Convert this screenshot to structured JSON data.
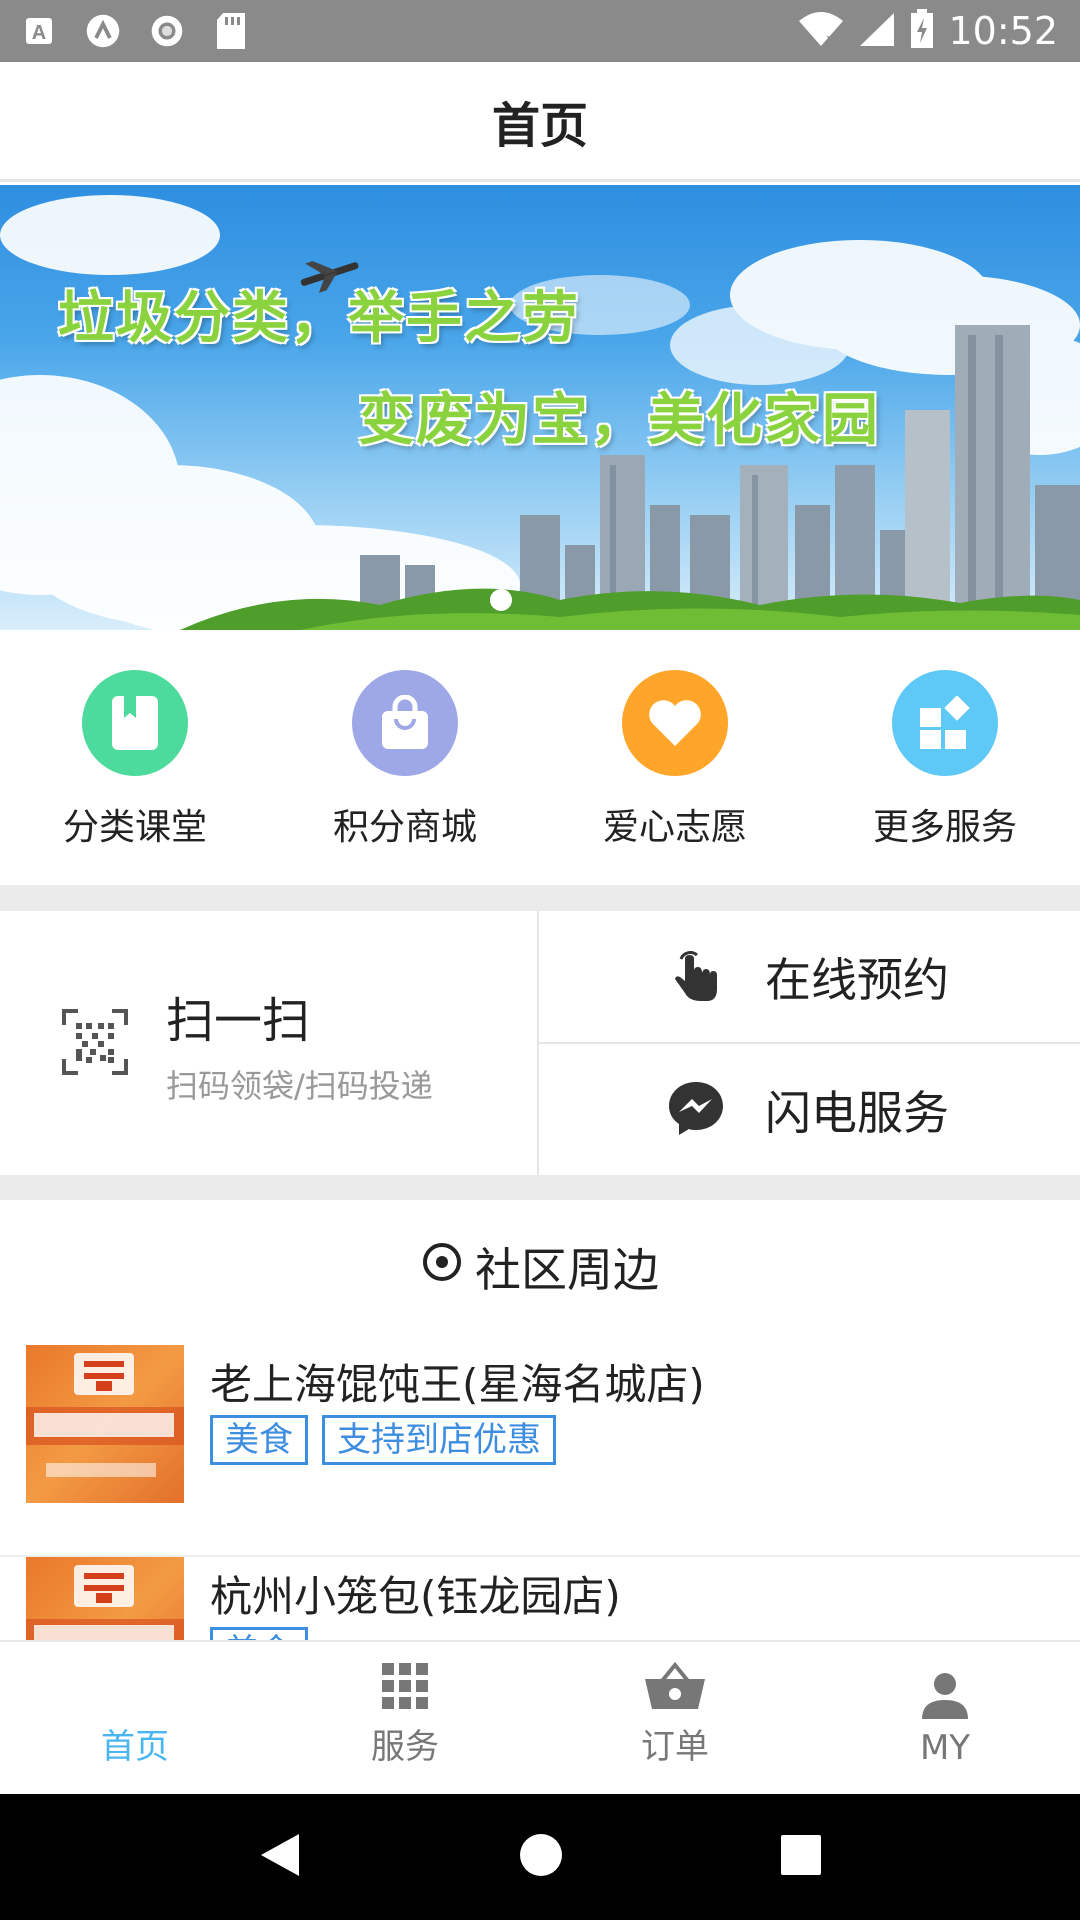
{
  "status_bar": {
    "time": "10:52",
    "icons": [
      "a-icon",
      "lambda-icon",
      "record-icon",
      "sd-card-icon",
      "wifi-icon",
      "signal-icon",
      "battery-icon"
    ]
  },
  "header": {
    "title": "首页"
  },
  "banner": {
    "line1": "垃圾分类，举手之劳",
    "line2": "变废为宝，美化家园",
    "slides_total": 1,
    "current_slide": 1
  },
  "quick_menu": [
    {
      "label": "分类课堂",
      "icon": "book-icon",
      "color": "#4cdb9c"
    },
    {
      "label": "积分商城",
      "icon": "shopping-bag-icon",
      "color": "#9fa8e6"
    },
    {
      "label": "爱心志愿",
      "icon": "heart-icon",
      "color": "#ffa52a"
    },
    {
      "label": "更多服务",
      "icon": "apps-icon",
      "color": "#5ec9f6"
    }
  ],
  "actions": {
    "scan": {
      "title": "扫一扫",
      "subtitle": "扫码领袋/扫码投递",
      "icon": "qr-code-icon"
    },
    "items": [
      {
        "label": "在线预约",
        "icon": "touch-icon"
      },
      {
        "label": "闪电服务",
        "icon": "messenger-icon"
      }
    ]
  },
  "community": {
    "title": "社区周边",
    "shops": [
      {
        "name": "老上海馄饨王(星海名城店)",
        "tags": [
          "美食",
          "支持到店优惠"
        ]
      },
      {
        "name": "杭州小笼包(钰龙园店)",
        "tags": [
          "美食"
        ]
      }
    ]
  },
  "tabbar": [
    {
      "label": "首页",
      "icon": "home-icon",
      "active": true
    },
    {
      "label": "服务",
      "icon": "grid-icon",
      "active": false
    },
    {
      "label": "订单",
      "icon": "basket-icon",
      "active": false
    },
    {
      "label": "MY",
      "icon": "person-icon",
      "active": false
    }
  ],
  "colors": {
    "accent": "#49b6ef",
    "tag": "#3d8ee0",
    "divider": "#ebebeb"
  }
}
